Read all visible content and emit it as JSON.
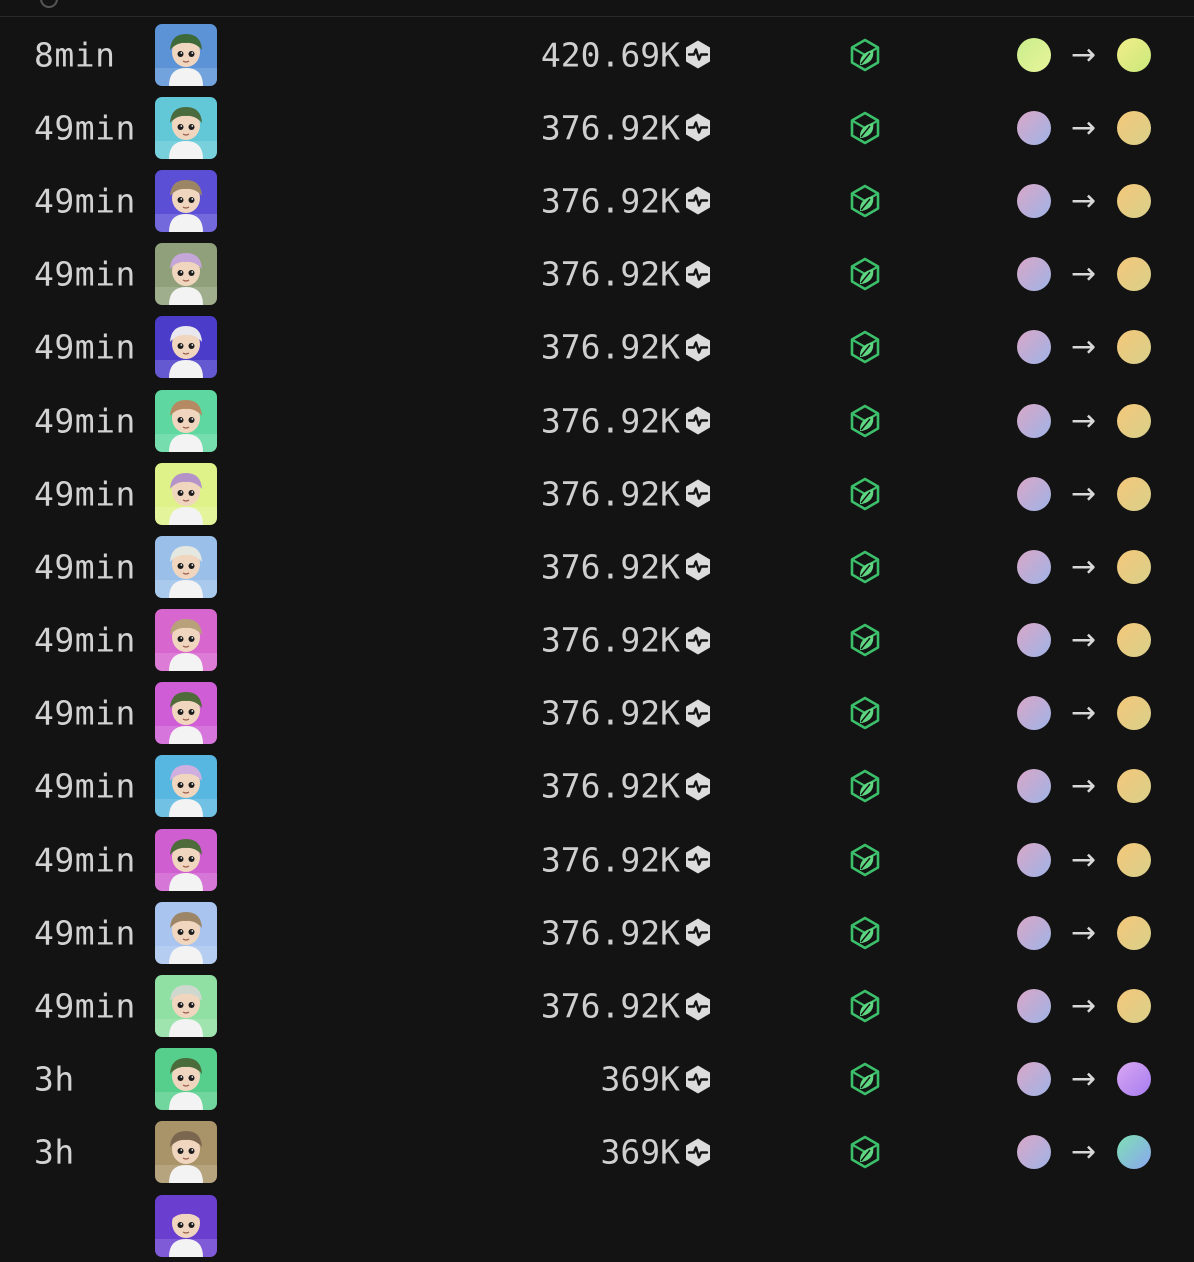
{
  "icons": {
    "price_unit": "flow-token-icon",
    "marketplace": "leaf-cube-icon",
    "transfer_arrow": "→"
  },
  "colors": {
    "background": "#131313",
    "cube_green": "#3bbf6a"
  },
  "rows": [
    {
      "time": "8min",
      "price": "420.69K",
      "avatar_bg": "#5b93d6",
      "hair": "#3e6a3a",
      "from": [
        "#c9ed8c",
        "#e8f59a"
      ],
      "to": [
        "#f2ee8a",
        "#c9e87a"
      ]
    },
    {
      "time": "49min",
      "price": "376.92K",
      "avatar_bg": "#62c8d8",
      "hair": "#4a6b3e",
      "from": [
        "#d9a7c7",
        "#9fb3e6"
      ],
      "to": [
        "#f4c77a",
        "#d9d08a"
      ]
    },
    {
      "time": "49min",
      "price": "376.92K",
      "avatar_bg": "#5b4fd6",
      "hair": "#9b8565",
      "from": [
        "#d9a7c7",
        "#9fb3e6"
      ],
      "to": [
        "#f4c77a",
        "#d9d08a"
      ]
    },
    {
      "time": "49min",
      "price": "376.92K",
      "avatar_bg": "#8fa07a",
      "hair": "#c4a6d8",
      "from": [
        "#d9a7c7",
        "#9fb3e6"
      ],
      "to": [
        "#f4c77a",
        "#d9d08a"
      ]
    },
    {
      "time": "49min",
      "price": "376.92K",
      "avatar_bg": "#4b3dc9",
      "hair": "#e8e8ee",
      "from": [
        "#d9a7c7",
        "#9fb3e6"
      ],
      "to": [
        "#f4c77a",
        "#d9d08a"
      ]
    },
    {
      "time": "49min",
      "price": "376.92K",
      "avatar_bg": "#5fd7a0",
      "hair": "#b58a62",
      "from": [
        "#d9a7c7",
        "#9fb3e6"
      ],
      "to": [
        "#f4c77a",
        "#d9d08a"
      ]
    },
    {
      "time": "49min",
      "price": "376.92K",
      "avatar_bg": "#dff28a",
      "hair": "#b493c9",
      "from": [
        "#d9a7c7",
        "#9fb3e6"
      ],
      "to": [
        "#f4c77a",
        "#d9d08a"
      ]
    },
    {
      "time": "49min",
      "price": "376.92K",
      "avatar_bg": "#9ac0ea",
      "hair": "#e4e8e0",
      "from": [
        "#d9a7c7",
        "#9fb3e6"
      ],
      "to": [
        "#f4c77a",
        "#d9d08a"
      ]
    },
    {
      "time": "49min",
      "price": "376.92K",
      "avatar_bg": "#d866cf",
      "hair": "#b8a07a",
      "from": [
        "#d9a7c7",
        "#9fb3e6"
      ],
      "to": [
        "#f4c77a",
        "#d9d08a"
      ]
    },
    {
      "time": "49min",
      "price": "376.92K",
      "avatar_bg": "#cf5ed6",
      "hair": "#4f6b3a",
      "from": [
        "#d9a7c7",
        "#9fb3e6"
      ],
      "to": [
        "#f4c77a",
        "#d9d08a"
      ]
    },
    {
      "time": "49min",
      "price": "376.92K",
      "avatar_bg": "#58b7e0",
      "hair": "#cfaee0",
      "from": [
        "#d9a7c7",
        "#9fb3e6"
      ],
      "to": [
        "#f4c77a",
        "#d9d08a"
      ]
    },
    {
      "time": "49min",
      "price": "376.92K",
      "avatar_bg": "#cf5ed0",
      "hair": "#4e6b3b",
      "from": [
        "#d9a7c7",
        "#9fb3e6"
      ],
      "to": [
        "#f4c77a",
        "#d9d08a"
      ]
    },
    {
      "time": "49min",
      "price": "376.92K",
      "avatar_bg": "#a9c5ef",
      "hair": "#9c8667",
      "from": [
        "#d9a7c7",
        "#9fb3e6"
      ],
      "to": [
        "#f4c77a",
        "#d9d08a"
      ]
    },
    {
      "time": "49min",
      "price": "376.92K",
      "avatar_bg": "#8fe0a2",
      "hair": "#cfd8cf",
      "from": [
        "#d9a7c7",
        "#9fb3e6"
      ],
      "to": [
        "#f4c77a",
        "#d9d08a"
      ]
    },
    {
      "time": "3h",
      "price": "369K",
      "avatar_bg": "#57cf8c",
      "hair": "#4a6b3a",
      "from": [
        "#d9a7c7",
        "#9fb3e6"
      ],
      "to": [
        "#d8a8f2",
        "#a77cf0"
      ]
    },
    {
      "time": "3h",
      "price": "369K",
      "avatar_bg": "#a89468",
      "hair": "#7b6650",
      "from": [
        "#d9a7c7",
        "#9fb3e6"
      ],
      "to": [
        "#7fe0b4",
        "#8aa6f0"
      ]
    },
    {
      "time": "",
      "price": "",
      "avatar_bg": "#6a3fd0",
      "hair": "#6a3fd0",
      "from": [
        "#131313",
        "#131313"
      ],
      "to": [
        "#131313",
        "#131313"
      ]
    }
  ]
}
